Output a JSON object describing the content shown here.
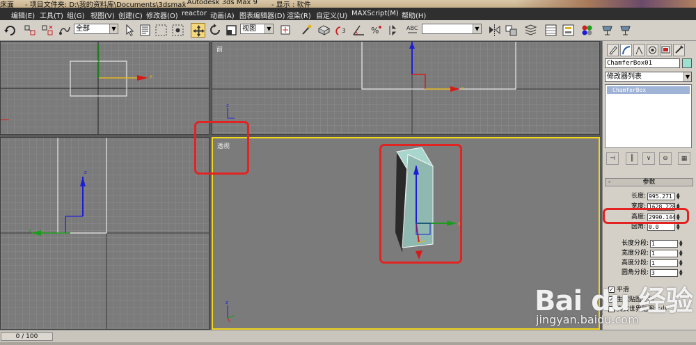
{
  "title": {
    "left_fragment": "床面",
    "project": "- 项目文件夹: D:\\我的资料库\\Documents\\3dsmax",
    "app": "- Autodesk 3ds Max 9",
    "display": "- 显示 : 软件"
  },
  "menu": [
    "编辑(E)",
    "工具(T)",
    "组(G)",
    "视图(V)",
    "创建(C)",
    "修改器(O)",
    "reactor",
    "动画(A)",
    "图表编辑器(D)",
    "渲染(R)",
    "自定义(U)",
    "MAXScript(M)",
    "帮助(H)"
  ],
  "toolbar": {
    "selection_filter": "全部",
    "ref_coord": "视图",
    "named_selection": "",
    "active_tool": "select-move"
  },
  "viewports": {
    "top": {
      "label": ""
    },
    "front": {
      "label": "前"
    },
    "left": {
      "label": ""
    },
    "perspective": {
      "label": "透视"
    }
  },
  "axes": {
    "x": "x",
    "y": "y",
    "z": "z"
  },
  "command_panel": {
    "object_name": "ChamferBox01",
    "object_color": "#9ce0d0",
    "modifier_list": "修改器列表",
    "stack_item": "ChamferBox",
    "rollout_title": "参数",
    "rollout_toggle": "-",
    "params": [
      {
        "label": "长度:",
        "value": "995.271"
      },
      {
        "label": "宽度:",
        "value": "1628.228"
      },
      {
        "label": "高度:",
        "value": "2990.144"
      },
      {
        "label": "圆角:",
        "value": "0.0"
      }
    ],
    "segments": [
      {
        "label": "长度分段:",
        "value": "1"
      },
      {
        "label": "宽度分段:",
        "value": "1"
      },
      {
        "label": "高度分段:",
        "value": "1"
      },
      {
        "label": "圆角分段:",
        "value": "3"
      }
    ],
    "checks": [
      {
        "label": "平滑",
        "checked": true
      },
      {
        "label": "生成贴图坐标",
        "checked": true
      },
      {
        "label": "真实世界贴图大小",
        "checked": false
      }
    ]
  },
  "timeline": {
    "frame": "0 / 100"
  },
  "watermark": {
    "brand": "Bai du 经验",
    "url": "jingyan.baidu.com"
  },
  "colors": {
    "active_viewport": "#f2d61c",
    "annotation": "#e32222",
    "box_face": "#8fb8b0",
    "axis_x": "#d61a1a",
    "axis_y": "#1c9c1c",
    "axis_z": "#1c1cd6"
  }
}
